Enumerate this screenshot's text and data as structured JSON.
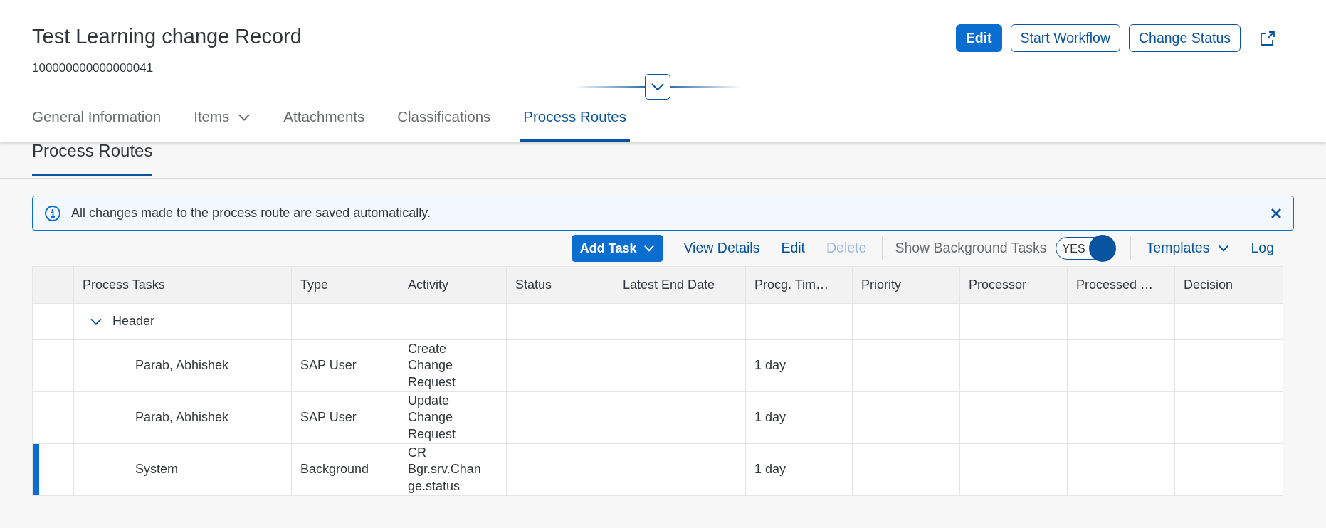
{
  "object_header": {
    "title": "Test Learning change Record",
    "id": "100000000000000041",
    "actions": [
      {
        "label": "Edit",
        "kind": "emphasized"
      },
      {
        "label": "Start Workflow",
        "kind": "outline"
      },
      {
        "label": "Change Status",
        "kind": "outline"
      },
      {
        "kind": "share"
      }
    ]
  },
  "tabs": [
    {
      "label": "General Information",
      "selected": false,
      "has_menu": false
    },
    {
      "label": "Items",
      "selected": false,
      "has_menu": true
    },
    {
      "label": "Attachments",
      "selected": false,
      "has_menu": false
    },
    {
      "label": "Classifications",
      "selected": false,
      "has_menu": false
    },
    {
      "label": "Process Routes",
      "selected": true,
      "has_menu": false
    }
  ],
  "section_title": "Process Routes",
  "message_strip": {
    "text": "All changes made to the process route are saved automatically."
  },
  "toolbar": [
    {
      "kind": "menu_button",
      "label": "Add Task"
    },
    {
      "kind": "button",
      "label": "View Details",
      "disabled": false
    },
    {
      "kind": "button",
      "label": "Edit",
      "disabled": false
    },
    {
      "kind": "button",
      "label": "Delete",
      "disabled": true
    },
    {
      "kind": "separator"
    },
    {
      "kind": "label",
      "label": "Show Background Tasks"
    },
    {
      "kind": "switch",
      "label": "YES",
      "on": true
    },
    {
      "kind": "separator"
    },
    {
      "kind": "menu",
      "label": "Templates"
    },
    {
      "kind": "button",
      "label": "Log",
      "disabled": false
    }
  ],
  "table": {
    "columns": [
      "Process Tasks",
      "Type",
      "Activity",
      "Status",
      "Latest End Date",
      "Procg. Tim…",
      "Priority",
      "Processor",
      "Processed …",
      "Decision"
    ],
    "rows": [
      {
        "process_tasks": "Header",
        "expanded": true,
        "highlighted": false,
        "children": [
          {
            "process_tasks": "Parab, Abhishek",
            "type": "SAP User",
            "activity": "Create Change Request",
            "procg_time": "1 day",
            "highlighted": false
          },
          {
            "process_tasks": "Parab, Abhishek",
            "type": "SAP User",
            "activity": "Update Change Request",
            "procg_time": "1 day",
            "highlighted": false
          },
          {
            "process_tasks": "System",
            "type": "Background",
            "activity": "CR Bgr.srv.Change.status",
            "procg_time": "1 day",
            "highlighted": true
          }
        ]
      }
    ]
  }
}
